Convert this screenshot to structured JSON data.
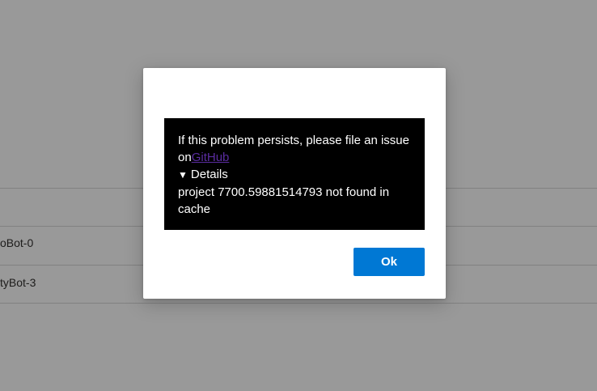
{
  "background": {
    "rows": [
      {
        "label": "oBot-0"
      },
      {
        "label": "tyBot-3"
      }
    ]
  },
  "dialog": {
    "message_text": "If this problem persists, please file an issue on",
    "link_text": "GitHub",
    "details_toggle_icon": "triangle-down-icon",
    "details_label": "Details",
    "details_text": "project 7700.59881514793 not found in cache",
    "ok_label": "Ok"
  },
  "colors": {
    "overlay": "#999999",
    "error_box_background": "#000000",
    "error_text": "#ffffff",
    "link": "#5a2ca0",
    "primary_button": "#0078d4"
  }
}
